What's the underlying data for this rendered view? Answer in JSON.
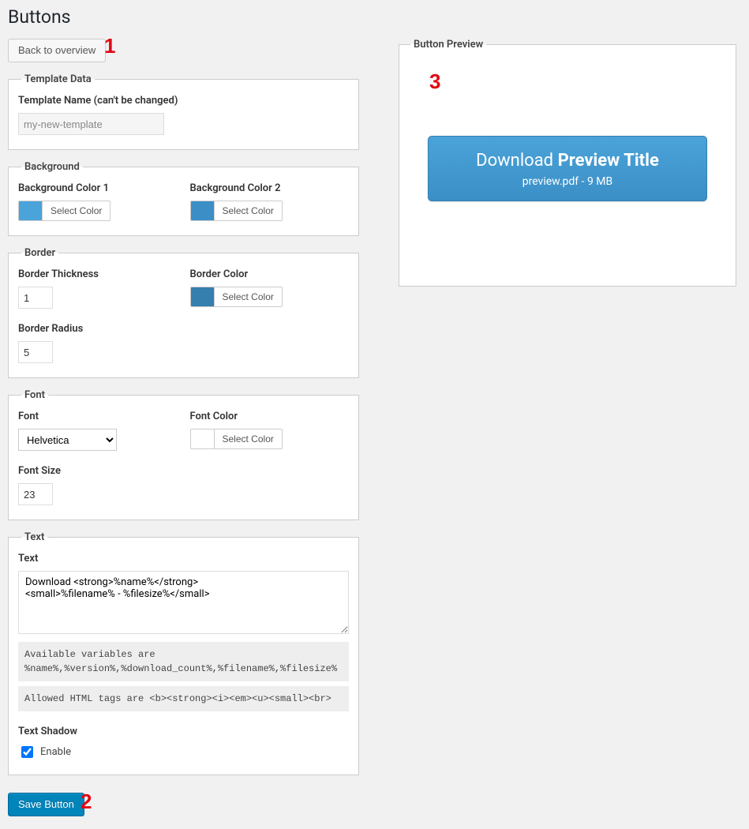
{
  "page": {
    "title": "Buttons"
  },
  "back_button": "Back to overview",
  "annotations": {
    "one": "1",
    "two": "2",
    "three": "3"
  },
  "template_data": {
    "legend": "Template Data",
    "name_label": "Template Name (can't be changed)",
    "name_value": "my-new-template"
  },
  "background": {
    "legend": "Background",
    "c1_label": "Background Color 1",
    "c2_label": "Background Color 2",
    "select_label": "Select Color",
    "c1_color": "#4aa3d9",
    "c2_color": "#3b8fc6"
  },
  "border": {
    "legend": "Border",
    "thickness_label": "Border Thickness",
    "thickness_value": "1",
    "color_label": "Border Color",
    "color_value": "#357faf",
    "select_label": "Select Color",
    "radius_label": "Border Radius",
    "radius_value": "5"
  },
  "font": {
    "legend": "Font",
    "font_label": "Font",
    "font_value": "Helvetica",
    "color_label": "Font Color",
    "select_label": "Select Color",
    "color_value": "#ffffff",
    "size_label": "Font Size",
    "size_value": "23"
  },
  "text": {
    "legend": "Text",
    "label": "Text",
    "value": "Download <strong>%name%</strong>\n<small>%filename% - %filesize%</small>",
    "hint1": "Available variables are\n%name%,%version%,%download_count%,%filename%,%filesize%",
    "hint2": "Allowed HTML tags are <b><strong><i><em><u><small><br>",
    "shadow_label": "Text Shadow",
    "enable_label": "Enable",
    "enable_checked": true
  },
  "save_button": "Save Button",
  "preview": {
    "legend": "Button Preview",
    "main_prefix": "Download ",
    "main_title": "Preview Title",
    "sub": "preview.pdf - 9 MB"
  }
}
